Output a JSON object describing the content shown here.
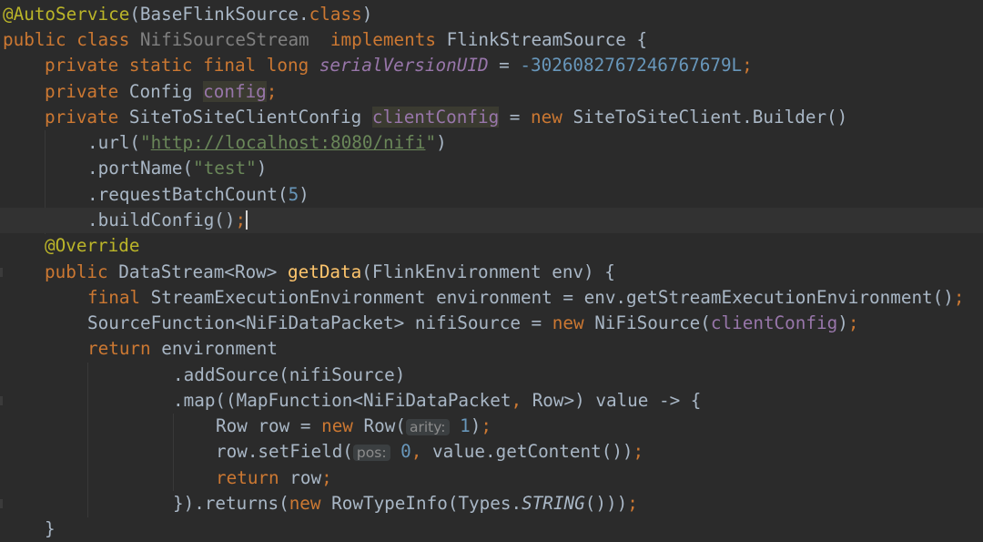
{
  "editor": {
    "language": "Java",
    "colors": {
      "background": "#2b2b2b",
      "current_line": "#323232",
      "keyword": "#cc7832",
      "annotation": "#bbb529",
      "string": "#6a8759",
      "number": "#6897bb",
      "field": "#9876aa",
      "method_declaration": "#ffc66d",
      "default_text": "#a9b7c6"
    },
    "lines": [
      {
        "tokens": [
          {
            "t": "@AutoService",
            "c": "annot"
          },
          {
            "t": "(BaseFlinkSource.",
            "c": "plain"
          },
          {
            "t": "class",
            "c": "kw"
          },
          {
            "t": ")",
            "c": "plain"
          }
        ]
      },
      {
        "tokens": [
          {
            "t": "public class ",
            "c": "kw"
          },
          {
            "t": "NifiSourceStream",
            "c": "gray"
          },
          {
            "t": "  ",
            "c": "plain"
          },
          {
            "t": "implements ",
            "c": "kw"
          },
          {
            "t": "FlinkStreamSource {",
            "c": "plain"
          }
        ]
      },
      {
        "tokens": [
          {
            "t": "private static final long ",
            "c": "kw"
          },
          {
            "t": "serialVersionUID",
            "c": "static"
          },
          {
            "t": " = ",
            "c": "plain"
          },
          {
            "t": "-3026082767246767679L",
            "c": "num"
          },
          {
            "t": ";",
            "c": "kw"
          }
        ]
      },
      {
        "tokens": [
          {
            "t": "private ",
            "c": "kw"
          },
          {
            "t": "Config ",
            "c": "plain"
          },
          {
            "t": "config",
            "c": "field",
            "hl": true
          },
          {
            "t": ";",
            "c": "kw"
          }
        ]
      },
      {
        "tokens": [
          {
            "t": "private ",
            "c": "kw"
          },
          {
            "t": "SiteToSiteClientConfig ",
            "c": "plain"
          },
          {
            "t": "clientConfig",
            "c": "field",
            "hl": true
          },
          {
            "t": " = ",
            "c": "plain"
          },
          {
            "t": "new ",
            "c": "kw"
          },
          {
            "t": "SiteToSiteClient.Builder()",
            "c": "plain"
          }
        ]
      },
      {
        "tokens": [
          {
            "t": ".url(",
            "c": "plain"
          },
          {
            "t": "\"",
            "c": "str"
          },
          {
            "t": "http://localhost:8080/nifi",
            "c": "link"
          },
          {
            "t": "\"",
            "c": "str"
          },
          {
            "t": ")",
            "c": "plain"
          }
        ]
      },
      {
        "tokens": [
          {
            "t": ".portName(",
            "c": "plain"
          },
          {
            "t": "\"test\"",
            "c": "str"
          },
          {
            "t": ")",
            "c": "plain"
          }
        ]
      },
      {
        "tokens": [
          {
            "t": ".requestBatchCount(",
            "c": "plain"
          },
          {
            "t": "5",
            "c": "num"
          },
          {
            "t": ")",
            "c": "plain"
          }
        ]
      },
      {
        "tokens": [
          {
            "t": ".buildConfig()",
            "c": "plain"
          },
          {
            "t": ";",
            "c": "kw"
          }
        ]
      },
      {
        "tokens": [
          {
            "t": "@Override",
            "c": "annot"
          }
        ]
      },
      {
        "tokens": [
          {
            "t": "public ",
            "c": "kw"
          },
          {
            "t": "DataStream<Row> ",
            "c": "plain"
          },
          {
            "t": "getData",
            "c": "method"
          },
          {
            "t": "(FlinkEnvironment env) {",
            "c": "plain"
          }
        ]
      },
      {
        "tokens": [
          {
            "t": "final ",
            "c": "kw"
          },
          {
            "t": "StreamExecutionEnvironment environment = env.getStreamExecutionEnvironment()",
            "c": "plain"
          },
          {
            "t": ";",
            "c": "kw"
          }
        ]
      },
      {
        "tokens": [
          {
            "t": "SourceFunction<NiFiDataPacket> nifiSource = ",
            "c": "plain"
          },
          {
            "t": "new ",
            "c": "kw"
          },
          {
            "t": "NiFiSource(",
            "c": "plain"
          },
          {
            "t": "clientConfig",
            "c": "field"
          },
          {
            "t": ")",
            "c": "plain"
          },
          {
            "t": ";",
            "c": "kw"
          }
        ]
      },
      {
        "tokens": [
          {
            "t": "return ",
            "c": "kw"
          },
          {
            "t": "environment",
            "c": "plain"
          }
        ]
      },
      {
        "tokens": [
          {
            "t": ".addSource(nifiSource)",
            "c": "plain"
          }
        ]
      },
      {
        "tokens": [
          {
            "t": ".map((MapFunction<NiFiDataPacket",
            "c": "plain"
          },
          {
            "t": ", ",
            "c": "kw"
          },
          {
            "t": "Row>) value -> {",
            "c": "plain"
          }
        ]
      },
      {
        "tokens": [
          {
            "t": "Row row = ",
            "c": "plain"
          },
          {
            "t": "new ",
            "c": "kw"
          },
          {
            "t": "Row(",
            "c": "plain"
          },
          {
            "t": "arity:",
            "c": "hint"
          },
          {
            "t": " ",
            "c": "plain"
          },
          {
            "t": "1",
            "c": "num"
          },
          {
            "t": ")",
            "c": "plain"
          },
          {
            "t": ";",
            "c": "kw"
          }
        ]
      },
      {
        "tokens": [
          {
            "t": "row.setField(",
            "c": "plain"
          },
          {
            "t": "pos:",
            "c": "hint"
          },
          {
            "t": " ",
            "c": "plain"
          },
          {
            "t": "0",
            "c": "num"
          },
          {
            "t": ", ",
            "c": "kw"
          },
          {
            "t": "value.getContent())",
            "c": "plain"
          },
          {
            "t": ";",
            "c": "kw"
          }
        ]
      },
      {
        "tokens": [
          {
            "t": "return ",
            "c": "kw"
          },
          {
            "t": "row",
            "c": "plain"
          },
          {
            "t": ";",
            "c": "kw"
          }
        ]
      },
      {
        "tokens": [
          {
            "t": "}).returns(",
            "c": "plain"
          },
          {
            "t": "new ",
            "c": "kw"
          },
          {
            "t": "RowTypeInfo(Types.",
            "c": "plain"
          },
          {
            "t": "STRING",
            "c": "italic"
          },
          {
            "t": "()))",
            "c": "plain"
          },
          {
            "t": ";",
            "c": "kw"
          }
        ]
      },
      {
        "tokens": [
          {
            "t": "}",
            "c": "plain"
          }
        ]
      }
    ]
  }
}
